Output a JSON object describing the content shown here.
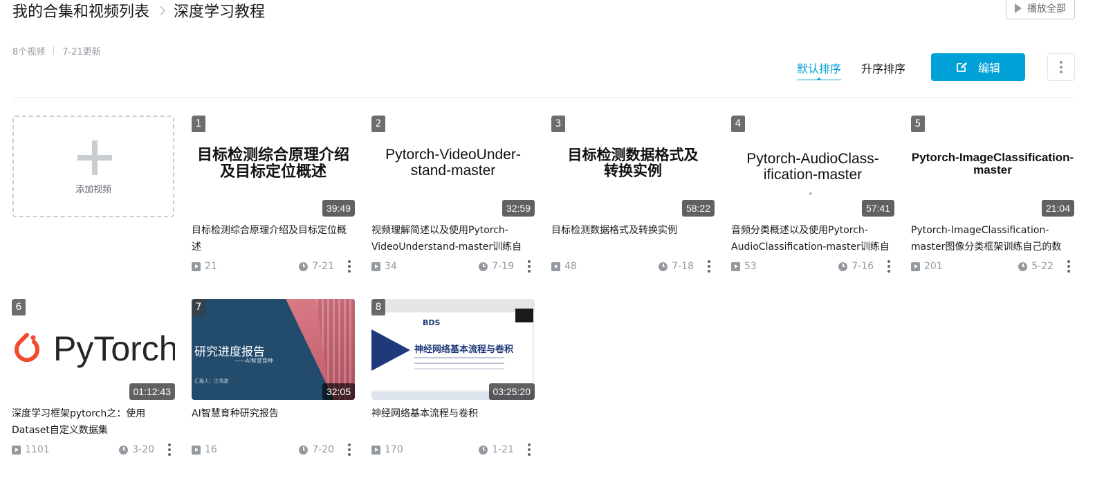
{
  "header": {
    "breadcrumb_root": "我的合集和视频列表",
    "breadcrumb_current": "深度学习教程",
    "play_all_label": "播放全部",
    "video_count": "8个视频",
    "updated": "7-21更新"
  },
  "toolbar": {
    "sort_default": "默认排序",
    "sort_ascending": "升序排序",
    "edit_label": "编辑"
  },
  "add_video": {
    "label": "添加视频"
  },
  "colors": {
    "accent": "#00a1d6",
    "text_muted": "#9499a0"
  },
  "videos": [
    {
      "index": "1",
      "thumb_text": "目标检测综合原理介绍及目标定位概述",
      "duration": "39:49",
      "title": "目标检测综合原理介绍及目标定位概述",
      "plays": "21",
      "date": "7-21"
    },
    {
      "index": "2",
      "thumb_text": "Pytorch-VideoUnder-stand-master",
      "duration": "32:59",
      "title": "视频理解简述以及使用Pytorch-VideoUnderstand-master训练自",
      "plays": "34",
      "date": "7-19"
    },
    {
      "index": "3",
      "thumb_text": "目标检测数据格式及转换实例",
      "duration": "58:22",
      "title": "目标检测数据格式及转换实例",
      "plays": "48",
      "date": "7-18"
    },
    {
      "index": "4",
      "thumb_text": "Pytorch-AudioClass-ification-master",
      "thumb_sub": "。",
      "duration": "57:41",
      "title": "音频分类概述以及使用Pytorch-AudioClassification-master训练自",
      "plays": "53",
      "date": "7-16"
    },
    {
      "index": "5",
      "thumb_text": "Pytorch-ImageClassification-master",
      "duration": "21:04",
      "title": "Pytorch-ImageClassification-master图像分类框架训练自己的数",
      "plays": "201",
      "date": "5-22"
    },
    {
      "index": "6",
      "thumb_text": "PyTorch",
      "duration": "01:12:43",
      "title": "深度学习框架pytorch之：使用Dataset自定义数据集",
      "plays": "1101",
      "date": "3-20"
    },
    {
      "index": "7",
      "thumb_text": "研究进度报告",
      "thumb_sub": "——AI智慧育种",
      "thumb_by": "汇报人：江鸿波",
      "duration": "32:05",
      "title": "AI智慧育种研究报告",
      "plays": "16",
      "date": "7-20"
    },
    {
      "index": "8",
      "thumb_text": "神经网络基本流程与卷积",
      "thumb_logo": "BDS",
      "duration": "03:25:20",
      "title": "神经网络基本流程与卷积",
      "plays": "170",
      "date": "1-21"
    }
  ]
}
